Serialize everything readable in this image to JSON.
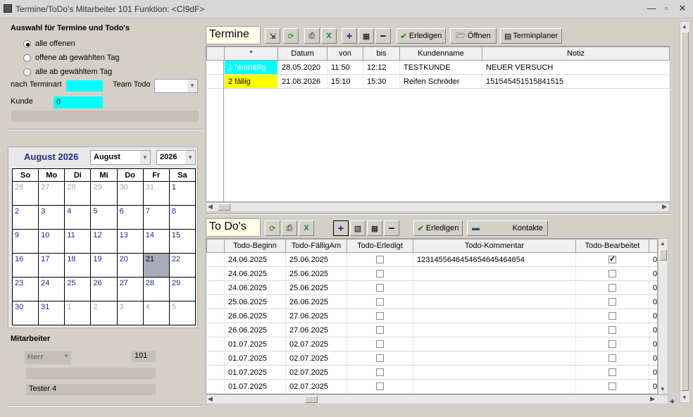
{
  "window": {
    "title": "Termine/ToDo's Mitarbeiter 101   Funktion: <CI9dF>"
  },
  "left": {
    "auswahl_title": "Auswahl für Termine und Todo's",
    "radio1": "alle offenen",
    "radio2": "offene ab gewählten Tag",
    "radio3": "alle ab gewähltem Tag",
    "nach_terminart": "nach Terminart",
    "team_todo": "Team Todo",
    "kunde": "Kunde",
    "kunde_value": "0",
    "cal_title": "August 2026",
    "month_select": "August",
    "year_select": "2026",
    "weekdays": [
      "So",
      "Mo",
      "Di",
      "Mi",
      "Do",
      "Fr",
      "Sa"
    ],
    "weeks": [
      [
        "26",
        "27",
        "28",
        "29",
        "30",
        "31",
        "1"
      ],
      [
        "2",
        "3",
        "4",
        "5",
        "6",
        "7",
        "8"
      ],
      [
        "9",
        "10",
        "11",
        "12",
        "13",
        "14",
        "15"
      ],
      [
        "16",
        "17",
        "18",
        "19",
        "20",
        "21",
        "22"
      ],
      [
        "23",
        "24",
        "25",
        "26",
        "27",
        "28",
        "29"
      ],
      [
        "30",
        "31",
        "1",
        "2",
        "3",
        "4",
        "5"
      ]
    ],
    "mitarbeiter_title": "Mitarbeiter",
    "anrede": "Herr",
    "ma_nr": "101",
    "ma_name": "Tester 4"
  },
  "termine": {
    "label": "Termine",
    "btn_erledigen": "Erledigen",
    "btn_oeffnen": "Öffnen",
    "btn_terminplaner": "Terminplaner",
    "columns": [
      "*",
      "Datum",
      "von",
      "bis",
      "Kundenname",
      "Notiz"
    ],
    "rows": [
      {
        "status": "1 überfällig",
        "datum": "28.05.2020",
        "von": "11:50",
        "bis": "12:12",
        "kunde": "TESTKUNDE",
        "notiz": "NEUER VERSUCH",
        "color": "#00ffff"
      },
      {
        "status": "2 fällig",
        "datum": "21.08.2026",
        "von": "15:10",
        "bis": "15:30",
        "kunde": "Reifen Schröder",
        "notiz": "151545451515841515",
        "color": "#ffff00"
      }
    ]
  },
  "todos": {
    "label": "To Do's",
    "btn_erledigen": "Erledigen",
    "btn_kontakte": "Kontakte",
    "columns": [
      "Todo-Beginn",
      "Todo-FälligAm",
      "Todo-Erledigt",
      "Todo-Kommentar",
      "Todo-Bearbeitet",
      "0"
    ],
    "rows": [
      {
        "beginn": "24.06.2025",
        "faellig": "25.06.2025",
        "erledigt": false,
        "kommentar": "1231455646454654645464654",
        "bearbeitet": true,
        "extra": "0"
      },
      {
        "beginn": "24.06.2025",
        "faellig": "25.06.2025",
        "erledigt": false,
        "kommentar": "",
        "bearbeitet": false,
        "extra": "0"
      },
      {
        "beginn": "24.06.2025",
        "faellig": "25.06.2025",
        "erledigt": false,
        "kommentar": "",
        "bearbeitet": false,
        "extra": "0"
      },
      {
        "beginn": "25.06.2025",
        "faellig": "26.06.2025",
        "erledigt": false,
        "kommentar": "",
        "bearbeitet": false,
        "extra": "0"
      },
      {
        "beginn": "26.06.2025",
        "faellig": "27.06.2025",
        "erledigt": false,
        "kommentar": "",
        "bearbeitet": false,
        "extra": "0"
      },
      {
        "beginn": "26.06.2025",
        "faellig": "27.06.2025",
        "erledigt": false,
        "kommentar": "",
        "bearbeitet": false,
        "extra": "0"
      },
      {
        "beginn": "01.07.2025",
        "faellig": "02.07.2025",
        "erledigt": false,
        "kommentar": "",
        "bearbeitet": false,
        "extra": "0"
      },
      {
        "beginn": "01.07.2025",
        "faellig": "02.07.2025",
        "erledigt": false,
        "kommentar": "",
        "bearbeitet": false,
        "extra": "0"
      },
      {
        "beginn": "01.07.2025",
        "faellig": "02.07.2025",
        "erledigt": false,
        "kommentar": "",
        "bearbeitet": false,
        "extra": "0"
      },
      {
        "beginn": "01.07.2025",
        "faellig": "02.07.2025",
        "erledigt": false,
        "kommentar": "",
        "bearbeitet": false,
        "extra": "0"
      }
    ]
  }
}
